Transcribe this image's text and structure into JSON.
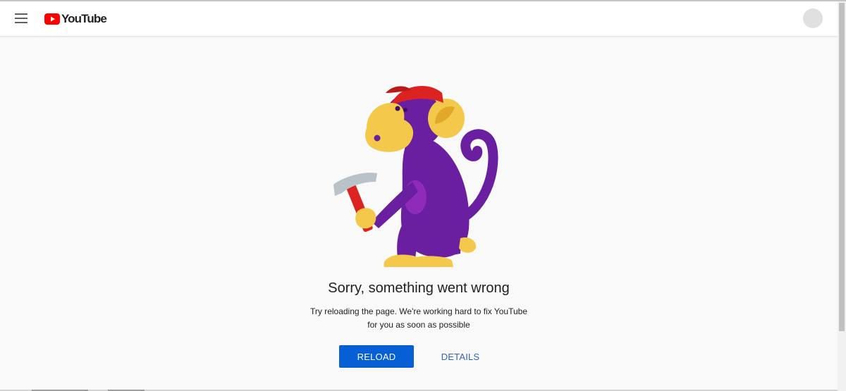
{
  "header": {
    "logo_text": "YouTube",
    "brand_color": "#ff0000"
  },
  "error": {
    "title": "Sorry, something went wrong",
    "message_line1": "Try reloading the page. We're working hard to fix YouTube",
    "message_line2": "for you as soon as possible"
  },
  "actions": {
    "reload_label": "RELOAD",
    "details_label": "DETAILS"
  },
  "colors": {
    "accent": "#065fd4",
    "link": "#3563b3",
    "mascot_purple": "#6a1fa0",
    "mascot_yellow": "#f4c84a",
    "cap_red": "#dd2222"
  },
  "icons": [
    "hamburger-menu-icon",
    "youtube-logo-icon",
    "avatar"
  ]
}
